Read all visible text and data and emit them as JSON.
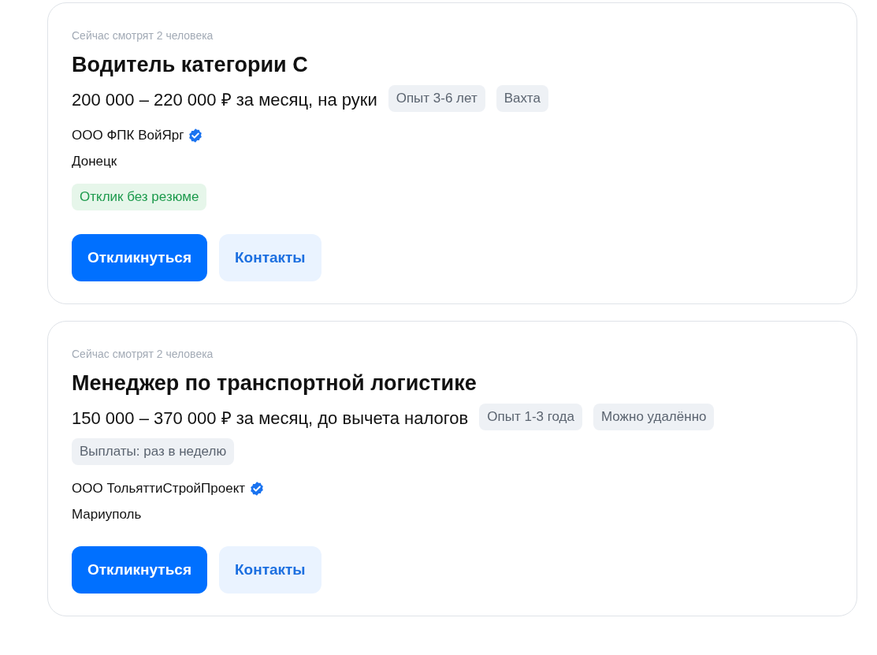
{
  "vacancies": [
    {
      "viewers": "Сейчас смотрят 2 человека",
      "title": "Водитель категории C",
      "salary": "200 000 – 220 000 ₽ за месяц, на руки",
      "tags": [
        "Опыт 3-6 лет",
        "Вахта"
      ],
      "company": "ООО ФПК ВойЯрг",
      "verified": true,
      "city": "Донецк",
      "perk": "Отклик без резюме",
      "buttons": [
        {
          "label": "Откликнуться",
          "kind": "primary"
        },
        {
          "label": "Контакты",
          "kind": "secondary"
        }
      ]
    },
    {
      "viewers": "Сейчас смотрят 2 человека",
      "title": "Менеджер по транспортной логистике",
      "salary": "150 000 – 370 000 ₽ за месяц, до вычета налогов",
      "tags": [
        "Опыт 1-3 года",
        "Можно удалённо",
        "Выплаты: раз в неделю"
      ],
      "company": "ООО ТольяттиСтройПроект",
      "verified": true,
      "city": "Мариуполь",
      "buttons": [
        {
          "label": "Откликнуться",
          "kind": "primary"
        },
        {
          "label": "Контакты",
          "kind": "secondary"
        }
      ]
    }
  ]
}
